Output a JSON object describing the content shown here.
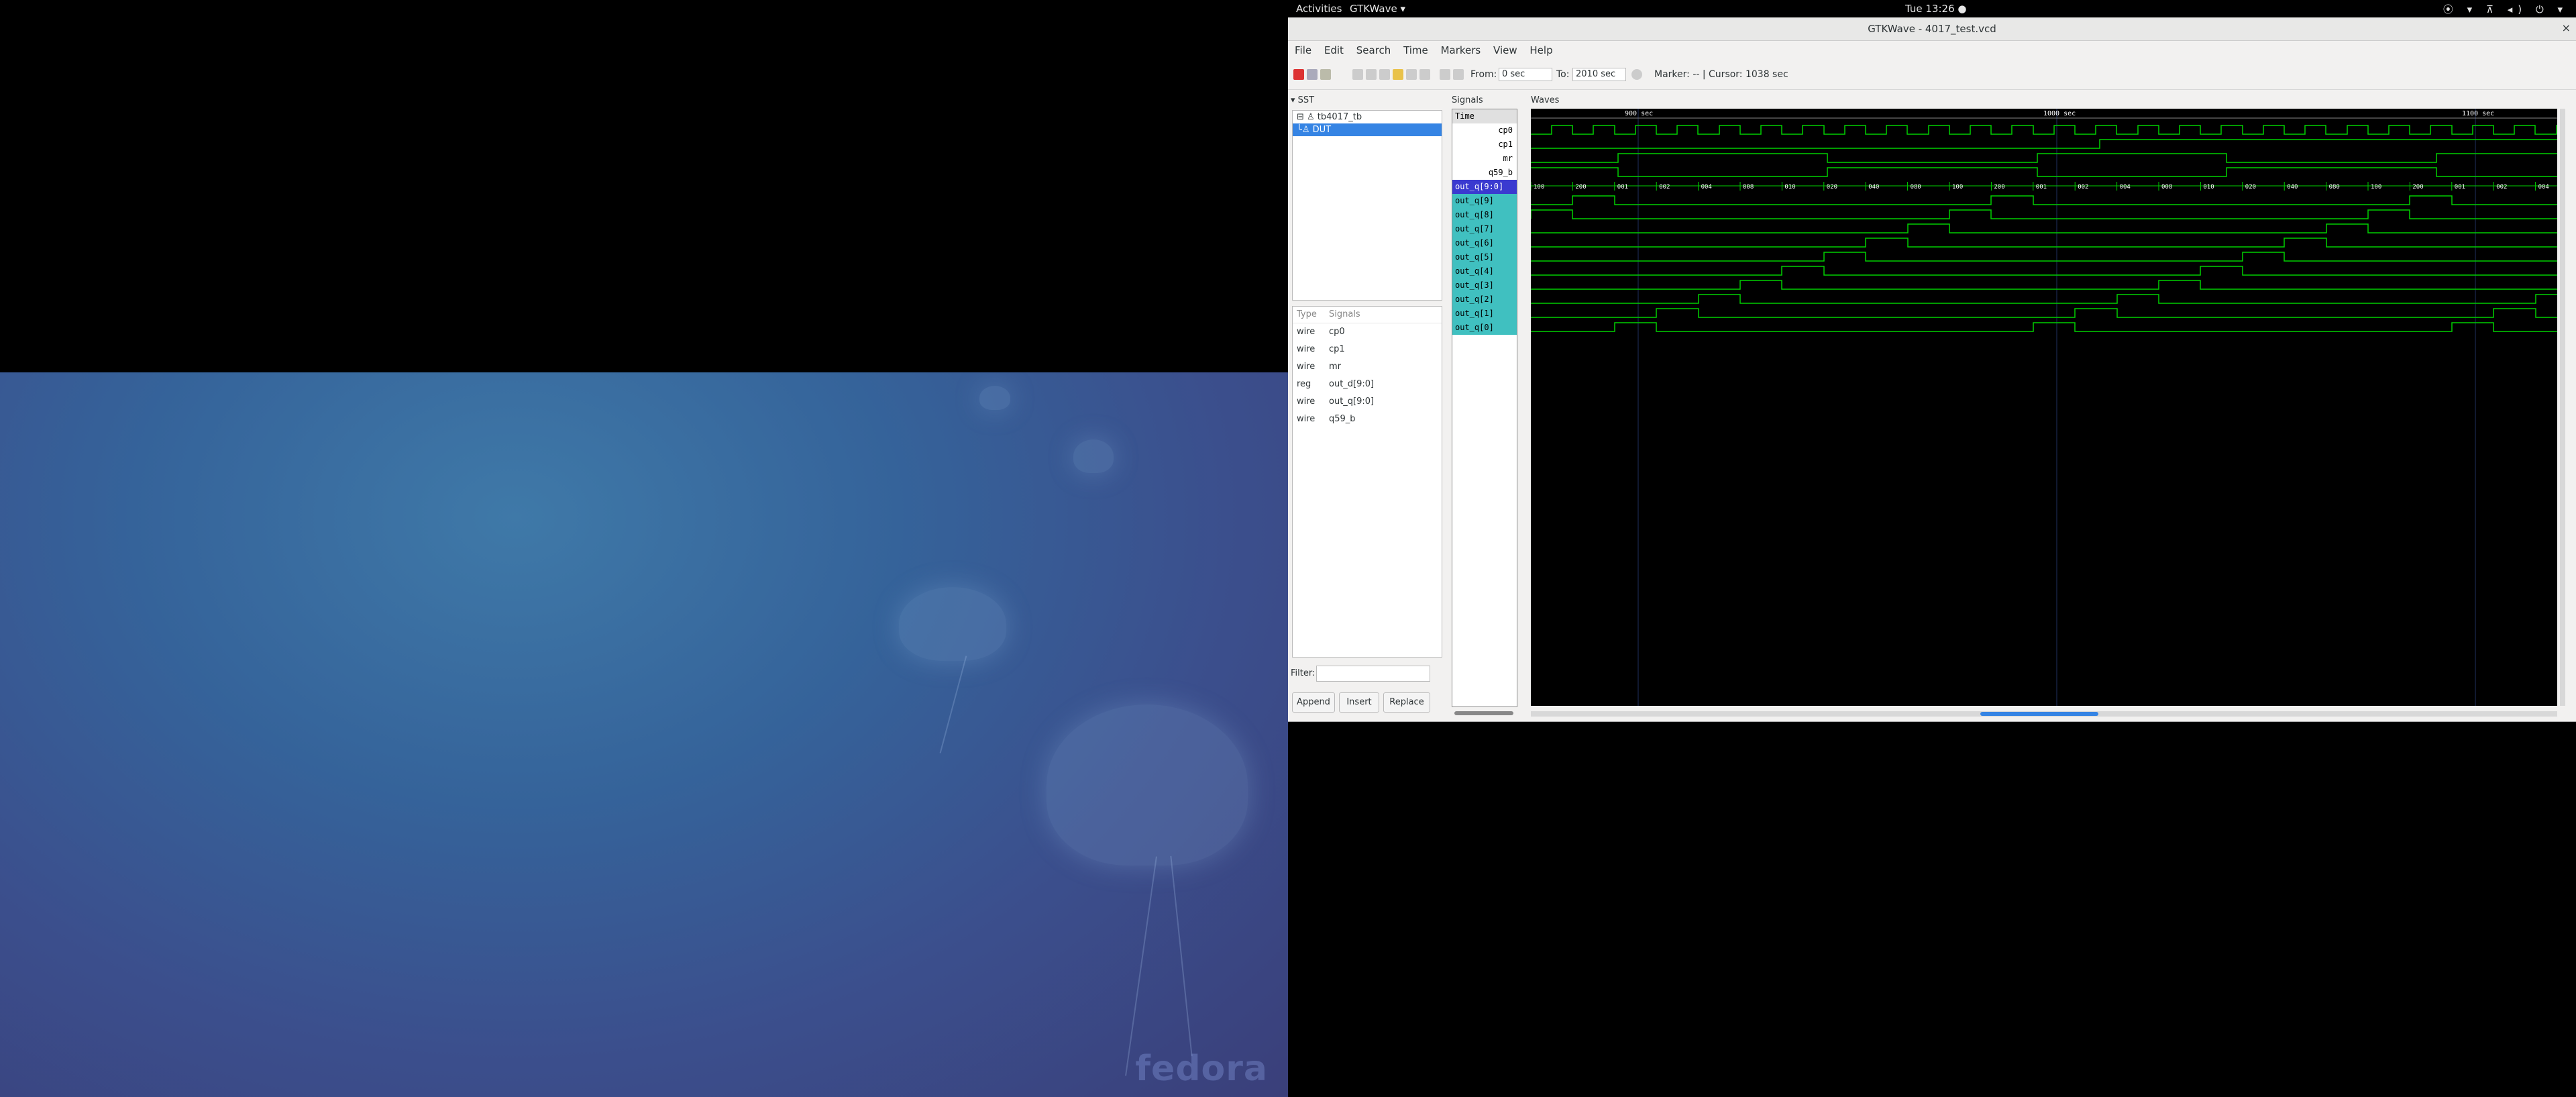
{
  "topbar": {
    "activities": "Activities",
    "app_menu": "GTKWave ▾",
    "clock": "Tue 13:26 ●",
    "tray": "⦿ ▾ ⊼ ◂) ⏻ ▾"
  },
  "window": {
    "title": "GTKWave - 4017_test.vcd",
    "close": "×"
  },
  "menu": [
    "File",
    "Edit",
    "Search",
    "Time",
    "Markers",
    "View",
    "Help"
  ],
  "toolbar": {
    "from_label": "From:",
    "from_value": "0 sec",
    "to_label": "To:",
    "to_value": "2010 sec",
    "marker": "Marker: --  |  Cursor: 1038 sec"
  },
  "sst": {
    "header": "▾ SST",
    "tree": [
      "⊟ ♙ tb4017_tb",
      "└♙ DUT"
    ]
  },
  "signal_table": {
    "col_type": "Type",
    "col_signals": "Signals",
    "rows": [
      {
        "type": "wire",
        "name": "cp0"
      },
      {
        "type": "wire",
        "name": "cp1"
      },
      {
        "type": "wire",
        "name": "mr"
      },
      {
        "type": "reg",
        "name": "out_d[9:0]"
      },
      {
        "type": "wire",
        "name": "out_q[9:0]"
      },
      {
        "type": "wire",
        "name": "q59_b"
      }
    ]
  },
  "filter_label": "Filter:",
  "buttons": {
    "append": "Append",
    "insert": "Insert",
    "replace": "Replace"
  },
  "signals_panel": {
    "header": "Signals",
    "names": [
      "Time",
      "cp0",
      "cp1",
      "mr",
      "q59_b",
      "out_q[9:0]",
      "out_q[9]",
      "out_q[8]",
      "out_q[7]",
      "out_q[6]",
      "out_q[5]",
      "out_q[4]",
      "out_q[3]",
      "out_q[2]",
      "out_q[1]",
      "out_q[0]"
    ]
  },
  "waves": {
    "header": "Waves",
    "time_labels": [
      "900 sec",
      "1000 sec",
      "1100 sec"
    ],
    "bus_values": [
      "100",
      "200",
      "001",
      "002",
      "004",
      "008",
      "010",
      "020",
      "040",
      "080",
      "100",
      "200",
      "001",
      "002",
      "004",
      "008",
      "010",
      "020",
      "040",
      "080",
      "100",
      "200",
      "001",
      "002",
      "004"
    ],
    "colors": {
      "wave": "#00d000",
      "bus_text": "#ffffff",
      "grid": "#203060",
      "timeline": "#ffffff"
    }
  }
}
